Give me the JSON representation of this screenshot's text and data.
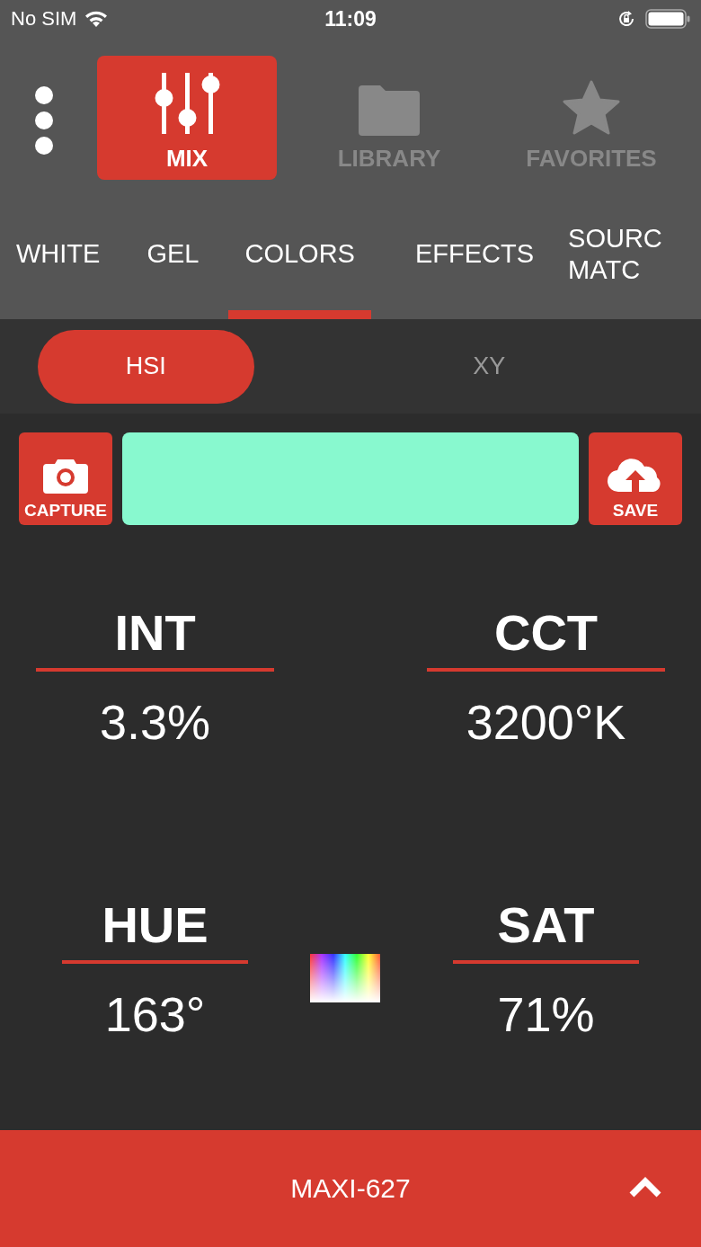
{
  "status_bar": {
    "carrier": "No SIM",
    "time": "11:09"
  },
  "nav": [
    {
      "kind": "mix",
      "label": "MIX",
      "selected": true
    },
    {
      "kind": "library",
      "label": "LIBRARY",
      "selected": false
    },
    {
      "kind": "favorites",
      "label": "FAVORITES",
      "selected": false
    }
  ],
  "tabs": [
    {
      "label": "WHITE",
      "selected": false
    },
    {
      "label": "GEL",
      "selected": false
    },
    {
      "label": "COLORS",
      "selected": true
    },
    {
      "label": "EFFECTS",
      "selected": false
    },
    {
      "label": "SOURC MATC",
      "selected": false
    }
  ],
  "modes": [
    {
      "label": "HSI",
      "selected": true
    },
    {
      "label": "XY",
      "selected": false
    }
  ],
  "capture_button": "CAPTURE",
  "preview": {
    "color": "#88f9cf"
  },
  "save_button": "SAVE",
  "params": [
    {
      "label": "INT",
      "value": "3.3%"
    },
    {
      "label": "CCT",
      "value": "3200°K"
    },
    {
      "label": "HUE",
      "value": "163°"
    },
    {
      "label": "SAT",
      "value": "71%"
    }
  ],
  "device": {
    "name": "MAXI-627"
  }
}
